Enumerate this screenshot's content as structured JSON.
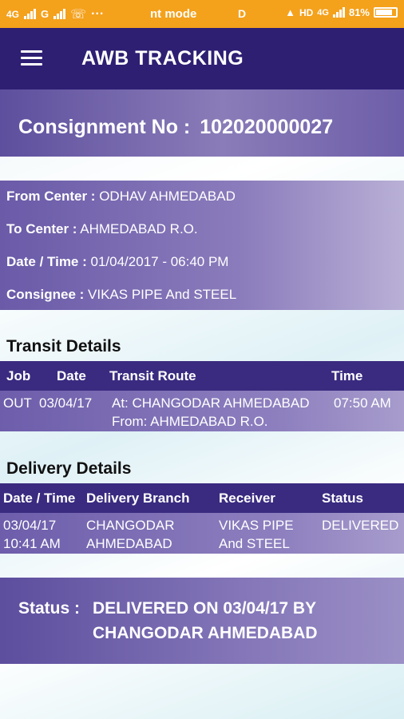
{
  "status_bar": {
    "net1": "4G",
    "net2": "G",
    "mode": "nt mode",
    "d": "D",
    "hd": "HD",
    "net3": "4G",
    "battery": "81%"
  },
  "app_bar": {
    "title": "AWB TRACKING"
  },
  "consignment": {
    "label": "Consignment No :",
    "number": "102020000027"
  },
  "details": {
    "from_label": "From Center :",
    "from_value": "ODHAV AHMEDABAD",
    "to_label": "To Center :",
    "to_value": "AHMEDABAD R.O.",
    "datetime_label": "Date / Time :",
    "datetime_value": "01/04/2017 - 06:40 PM",
    "consignee_label": "Consignee :",
    "consignee_value": "VIKAS PIPE And STEEL"
  },
  "transit": {
    "title": "Transit Details",
    "headers": [
      "Job",
      "Date",
      "Transit Route",
      "Time"
    ],
    "rows": [
      {
        "job": "OUT",
        "date": "03/04/17",
        "route_at": "At: CHANGODAR AHMEDABAD",
        "route_from": "From: AHMEDABAD R.O.",
        "time": "07:50 AM"
      }
    ]
  },
  "delivery": {
    "title": "Delivery Details",
    "headers": [
      "Date / Time",
      "Delivery Branch",
      "Receiver",
      "Status"
    ],
    "rows": [
      {
        "date": "03/04/17",
        "time": "10:41 AM",
        "branch1": "CHANGODAR",
        "branch2": "AHMEDABAD",
        "receiver1": "VIKAS PIPE",
        "receiver2": "And STEEL",
        "status": "DELIVERED"
      }
    ]
  },
  "status": {
    "label": "Status :",
    "line1": "DELIVERED ON 03/04/17 BY",
    "line2": "CHANGODAR AHMEDABAD"
  },
  "colors": {
    "status_bar": "#f4a11c",
    "app_bar": "#2e1f73",
    "table_header": "#3a2b80",
    "band": "#7a6bb3"
  }
}
